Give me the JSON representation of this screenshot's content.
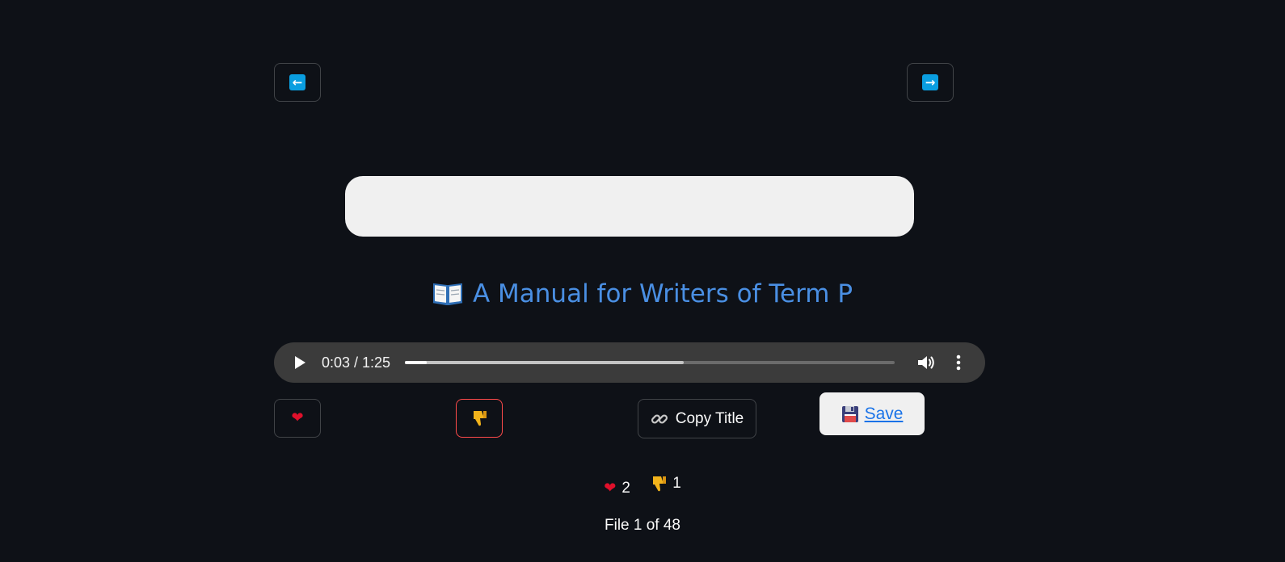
{
  "nav": {
    "prev_icon": "left-arrow-icon",
    "next_icon": "right-arrow-icon",
    "accent_color": "#0a9ee0"
  },
  "title": {
    "icon": "open-book-icon",
    "text": "A Manual for Writers of Term P",
    "color": "#4a8fe3"
  },
  "audio": {
    "current_time": "0:03",
    "duration": "1:25",
    "time_display": "0:03 / 1:25",
    "played_fraction": 0.045,
    "buffered_fraction": 0.57,
    "play_icon": "play-icon",
    "volume_icon": "volume-icon",
    "more_icon": "more-options-icon"
  },
  "actions": {
    "like_icon": "heart-icon",
    "dislike_icon": "thumbs-down-icon",
    "copy_icon": "link-icon",
    "copy_label": "Copy Title",
    "save_icon": "floppy-disk-icon",
    "save_label": "Save"
  },
  "counts": {
    "likes": "2",
    "dislikes": "1"
  },
  "file_counter": "File 1 of 48",
  "colors": {
    "background": "#0e1117",
    "danger_border": "#ff4b4b",
    "link": "#1a73e8"
  }
}
